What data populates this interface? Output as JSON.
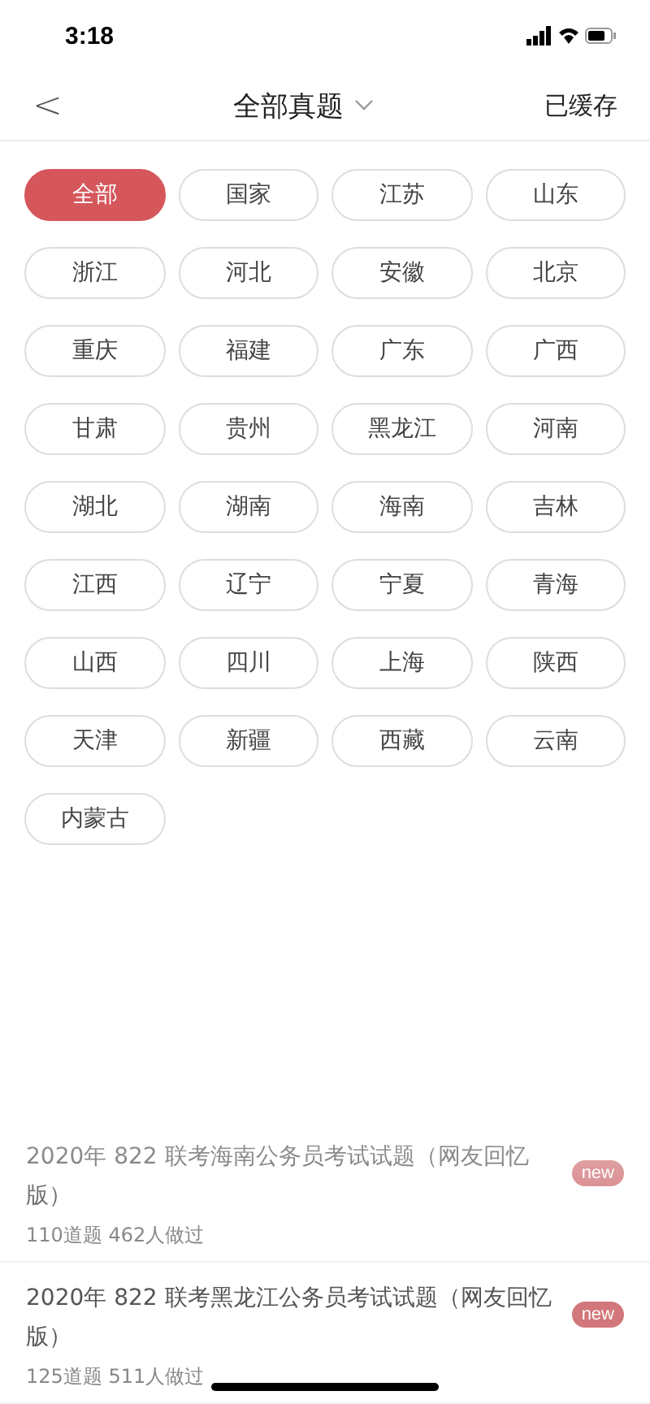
{
  "status_bar": {
    "time": "3:18"
  },
  "nav": {
    "back": "<",
    "title": "全部真题",
    "action": "已缓存"
  },
  "regions": [
    {
      "label": "全部",
      "selected": true
    },
    {
      "label": "国家",
      "selected": false
    },
    {
      "label": "江苏",
      "selected": false
    },
    {
      "label": "山东",
      "selected": false
    },
    {
      "label": "浙江",
      "selected": false
    },
    {
      "label": "河北",
      "selected": false
    },
    {
      "label": "安徽",
      "selected": false
    },
    {
      "label": "北京",
      "selected": false
    },
    {
      "label": "重庆",
      "selected": false
    },
    {
      "label": "福建",
      "selected": false
    },
    {
      "label": "广东",
      "selected": false
    },
    {
      "label": "广西",
      "selected": false
    },
    {
      "label": "甘肃",
      "selected": false
    },
    {
      "label": "贵州",
      "selected": false
    },
    {
      "label": "黑龙江",
      "selected": false
    },
    {
      "label": "河南",
      "selected": false
    },
    {
      "label": "湖北",
      "selected": false
    },
    {
      "label": "湖南",
      "selected": false
    },
    {
      "label": "海南",
      "selected": false
    },
    {
      "label": "吉林",
      "selected": false
    },
    {
      "label": "江西",
      "selected": false
    },
    {
      "label": "辽宁",
      "selected": false
    },
    {
      "label": "宁夏",
      "selected": false
    },
    {
      "label": "青海",
      "selected": false
    },
    {
      "label": "山西",
      "selected": false
    },
    {
      "label": "四川",
      "selected": false
    },
    {
      "label": "上海",
      "selected": false
    },
    {
      "label": "陕西",
      "selected": false
    },
    {
      "label": "天津",
      "selected": false
    },
    {
      "label": "新疆",
      "selected": false
    },
    {
      "label": "西藏",
      "selected": false
    },
    {
      "label": "云南",
      "selected": false
    },
    {
      "label": "内蒙古",
      "selected": false
    }
  ],
  "papers": [
    {
      "title": "2020年 822 联考海南公务员考试试题（网友回忆版）",
      "badge": "new",
      "meta": "110道题  462人做过"
    },
    {
      "title": "2020年 822 联考黑龙江公务员考试试题（网友回忆版）",
      "badge": "new",
      "meta": "125道题  511人做过"
    }
  ]
}
